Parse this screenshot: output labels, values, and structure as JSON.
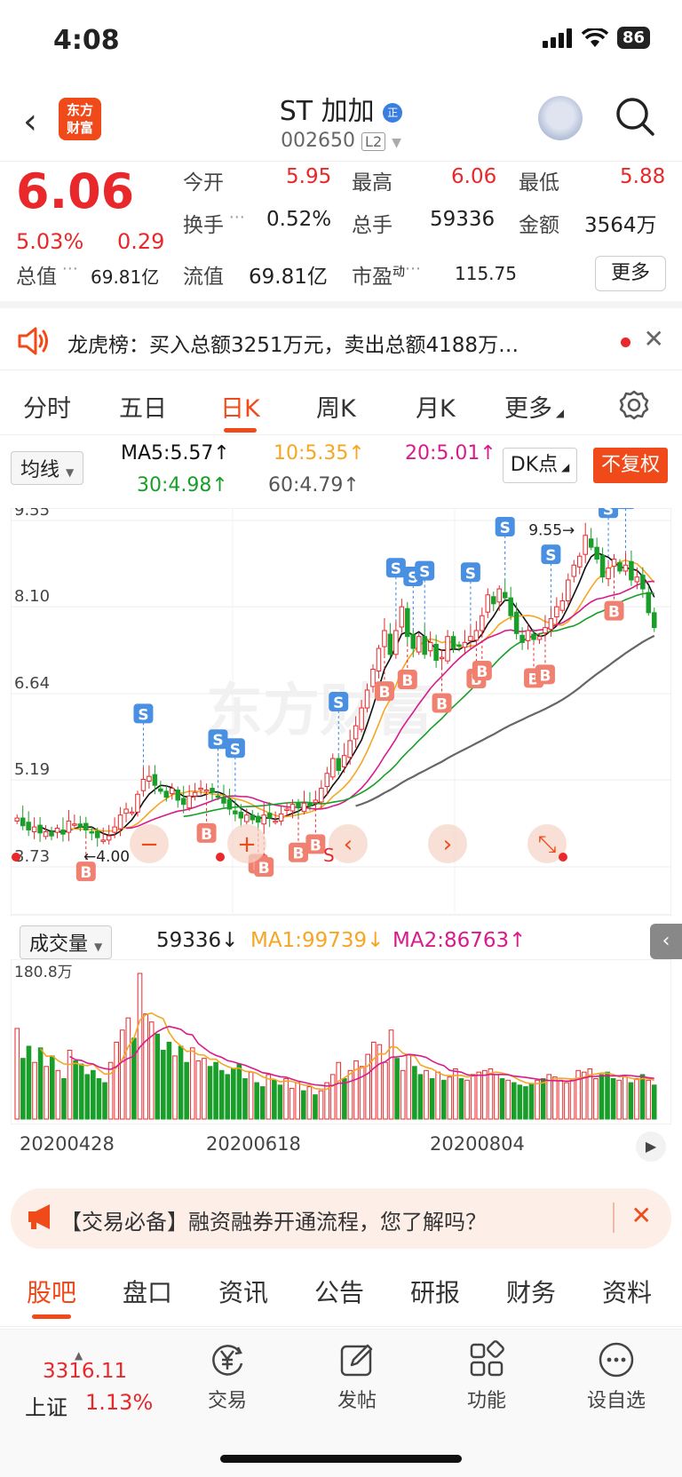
{
  "status": {
    "time": "4:08",
    "battery": "86"
  },
  "nav": {
    "title": "ST 加加",
    "code": "002650",
    "level": "L2",
    "logo_line1": "东方",
    "logo_line2": "财富",
    "badge": "正"
  },
  "quote": {
    "price": "6.06",
    "change_pct": "5.03%",
    "change": "0.29",
    "open_label": "今开",
    "open": "5.95",
    "high_label": "最高",
    "high": "6.06",
    "low_label": "最低",
    "low": "5.88",
    "turnover_label": "换手",
    "turnover": "0.52%",
    "volume_label": "总手",
    "volume": "59336",
    "amount_label": "金额",
    "amount": "3564万",
    "mktcap_label": "总值",
    "mktcap": "69.81亿",
    "float_label": "流值",
    "float": "69.81亿",
    "pe_label": "市盈",
    "pe_sup": "动",
    "pe": "115.75",
    "more": "更多"
  },
  "lhb": {
    "text": "龙虎榜：买入总额3251万元，卖出总额4188万…"
  },
  "ktabs": [
    {
      "label": "分时",
      "active": false
    },
    {
      "label": "五日",
      "active": false
    },
    {
      "label": "日K",
      "active": true
    },
    {
      "label": "周K",
      "active": false
    },
    {
      "label": "月K",
      "active": false
    },
    {
      "label": "更多",
      "active": false
    }
  ],
  "ma": {
    "selector": "均线",
    "ma5": "MA5:5.57↑",
    "ma10": "10:5.35↑",
    "ma20": "20:5.01↑",
    "ma30": "30:4.98↑",
    "ma60": "60:4.79↑",
    "dk": "DK点",
    "fq": "不复权"
  },
  "colors": {
    "up": "#e8282b",
    "down": "#1a9e2a",
    "accent": "#f04a1a",
    "ma5": "#111111",
    "ma10": "#f5a623",
    "ma20": "#d81b8c",
    "ma30": "#1a9e2a",
    "ma60": "#666666"
  },
  "chart_data": [
    {
      "type": "candlestick",
      "yticks": [
        "9.55",
        "8.10",
        "6.64",
        "5.19",
        "3.73"
      ],
      "ylim": [
        3.73,
        9.55
      ],
      "max_label": "9.55",
      "min_label": "4.00",
      "xlabels": [
        "20200428",
        "20200618",
        "20200804"
      ],
      "closes": [
        4.55,
        4.42,
        4.35,
        4.4,
        4.3,
        4.32,
        4.25,
        4.38,
        4.28,
        4.5,
        4.45,
        4.4,
        4.35,
        4.3,
        4.22,
        4.18,
        4.25,
        4.4,
        4.6,
        4.7,
        4.65,
        4.95,
        5.2,
        5.25,
        5.1,
        5.0,
        4.9,
        5.05,
        4.85,
        4.78,
        4.92,
        4.98,
        5.05,
        5.02,
        4.98,
        4.9,
        4.8,
        4.7,
        4.62,
        4.55,
        4.6,
        4.52,
        4.48,
        4.6,
        4.55,
        4.5,
        4.62,
        4.7,
        4.78,
        4.72,
        4.8,
        4.75,
        4.85,
        5.05,
        5.3,
        5.55,
        5.35,
        5.6,
        5.85,
        6.1,
        6.4,
        6.7,
        7.05,
        7.4,
        7.7,
        7.3,
        7.7,
        8.1,
        7.6,
        7.4,
        7.6,
        7.3,
        7.5,
        7.2,
        7.25,
        7.6,
        7.4,
        7.45,
        7.5,
        7.6,
        7.7,
        7.95,
        8.3,
        8.15,
        8.4,
        8.25,
        7.95,
        7.65,
        7.5,
        7.7,
        7.55,
        7.6,
        7.75,
        7.9,
        8.1,
        8.2,
        8.55,
        8.8,
        8.95,
        9.3,
        9.1,
        8.9,
        8.6,
        8.75,
        8.9,
        8.7,
        8.8,
        8.55,
        8.6,
        8.4,
        8.0,
        7.75
      ],
      "signals": [
        {
          "label": "S",
          "i": 22
        },
        {
          "label": "S",
          "i": 35
        },
        {
          "label": "S",
          "i": 38
        },
        {
          "label": "S",
          "i": 56
        },
        {
          "label": "S",
          "i": 66
        },
        {
          "label": "S",
          "i": 69
        },
        {
          "label": "S",
          "i": 71
        },
        {
          "label": "S",
          "i": 79
        },
        {
          "label": "S",
          "i": 85
        },
        {
          "label": "S",
          "i": 93
        },
        {
          "label": "S",
          "i": 103
        },
        {
          "label": "S",
          "i": 106
        },
        {
          "label": "B",
          "i": 12
        },
        {
          "label": "B",
          "i": 33
        },
        {
          "label": "B",
          "i": 42
        },
        {
          "label": "B",
          "i": 43
        },
        {
          "label": "B",
          "i": 49
        },
        {
          "label": "B",
          "i": 52
        },
        {
          "label": "B",
          "i": 64
        },
        {
          "label": "B",
          "i": 68
        },
        {
          "label": "B",
          "i": 74
        },
        {
          "label": "B",
          "i": 80
        },
        {
          "label": "B",
          "i": 81
        },
        {
          "label": "B",
          "i": 90
        },
        {
          "label": "B",
          "i": 92
        },
        {
          "label": "B",
          "i": 104
        }
      ],
      "tools": [
        "−",
        "+",
        "‹",
        "›",
        "⤡"
      ],
      "s_marker": "S"
    },
    {
      "type": "bar",
      "name": "成交量",
      "ytick": "180.8万",
      "values": [
        112,
        75,
        90,
        70,
        88,
        65,
        78,
        60,
        50,
        85,
        72,
        68,
        55,
        60,
        50,
        45,
        70,
        95,
        110,
        125,
        100,
        180,
        130,
        120,
        105,
        85,
        95,
        78,
        90,
        70,
        88,
        72,
        75,
        65,
        70,
        60,
        55,
        62,
        68,
        50,
        58,
        45,
        40,
        55,
        48,
        42,
        50,
        38,
        45,
        35,
        40,
        30,
        35,
        45,
        55,
        70,
        50,
        60,
        72,
        65,
        80,
        95,
        92,
        70,
        110,
        75,
        60,
        80,
        65,
        55,
        60,
        50,
        58,
        48,
        52,
        62,
        50,
        48,
        55,
        58,
        60,
        62,
        55,
        50,
        48,
        45,
        42,
        40,
        44,
        48,
        50,
        55,
        52,
        48,
        45,
        48,
        60,
        58,
        62,
        50,
        55,
        58,
        50,
        48,
        52,
        45,
        50,
        55,
        48,
        42
      ],
      "ma1_label": "MA1:99739↓",
      "ma2_label": "MA2:86763↑",
      "current": "59336↓"
    }
  ],
  "volume": {
    "selector": "成交量"
  },
  "ad": {
    "text": "【交易必备】融资融券开通流程，您了解吗？"
  },
  "btabs": [
    {
      "label": "股吧",
      "active": true
    },
    {
      "label": "盘口",
      "active": false
    },
    {
      "label": "资讯",
      "active": false
    },
    {
      "label": "公告",
      "active": false
    },
    {
      "label": "研报",
      "active": false
    },
    {
      "label": "财务",
      "active": false
    },
    {
      "label": "资料",
      "active": false
    }
  ],
  "bottom": {
    "index_value": "3316.11",
    "index_name": "上证",
    "index_pct": "1.13%",
    "items": [
      {
        "label": "交易",
        "icon": "yen-icon"
      },
      {
        "label": "发帖",
        "icon": "edit-icon"
      },
      {
        "label": "功能",
        "icon": "grid-icon"
      },
      {
        "label": "设自选",
        "icon": "dots-icon"
      }
    ]
  }
}
